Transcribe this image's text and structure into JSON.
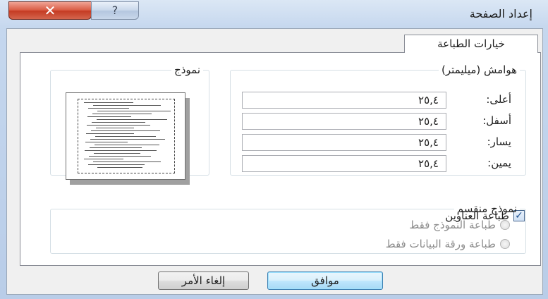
{
  "window": {
    "title": "إعداد الصفحة",
    "close_glyph": "✕",
    "help_glyph": "?"
  },
  "tabs": [
    {
      "label": "خيارات الطباعة"
    }
  ],
  "margins": {
    "legend": "هوامش (ميليمتر)",
    "fields": [
      {
        "label": "أعلى:",
        "value": "٢٥,٤"
      },
      {
        "label": "أسفل:",
        "value": "٢٥,٤"
      },
      {
        "label": "يسار:",
        "value": "٢٥,٤"
      },
      {
        "label": "يمين:",
        "value": "٢٥,٤"
      }
    ]
  },
  "preview": {
    "legend": "نموذج"
  },
  "print_headings": {
    "label": "طباعة العناوين",
    "checked": true,
    "check_glyph": "✓"
  },
  "split_form": {
    "legend": "نموذج منقسم",
    "options": [
      {
        "label": "طباعة النموذج فقط",
        "enabled": false
      },
      {
        "label": "طباعة ورقة البيانات فقط",
        "enabled": false
      }
    ]
  },
  "buttons": {
    "ok": "موافق",
    "cancel": "إلغاء الأمر"
  },
  "colors": {
    "accent": "#3c7fb1",
    "close": "#c43a22"
  },
  "icons": {
    "close": "close-icon",
    "help": "help-icon",
    "check": "checkmark-icon"
  }
}
